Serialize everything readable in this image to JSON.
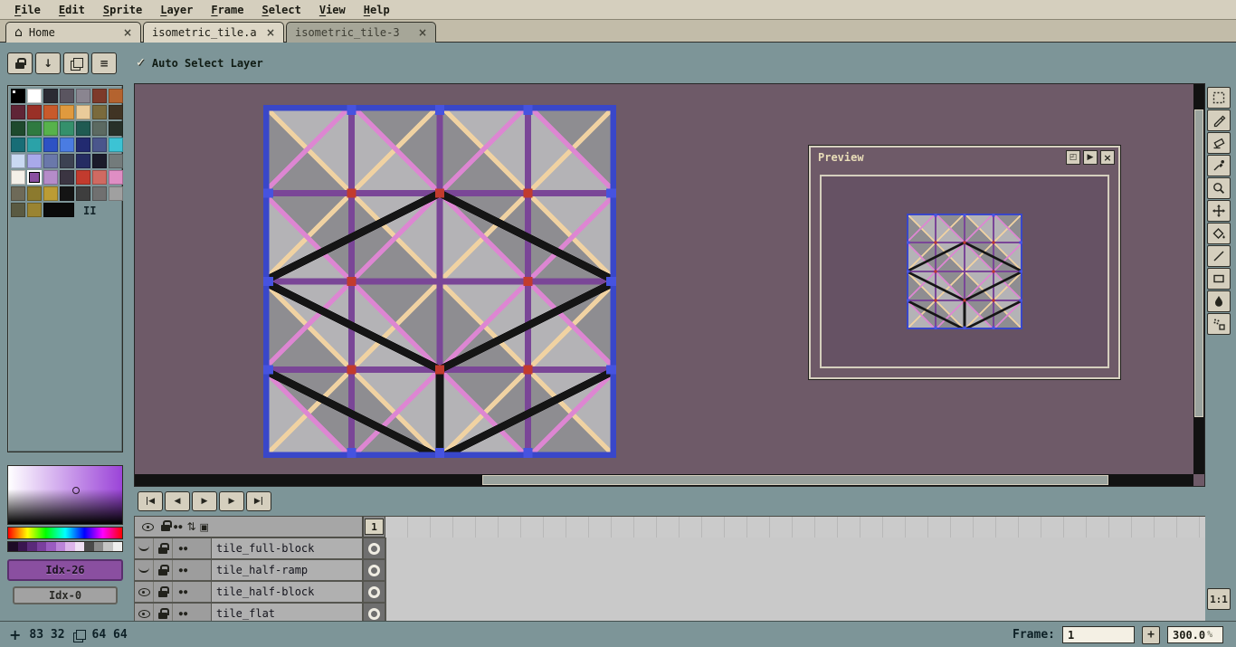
{
  "app": {
    "bg": "#7d9598",
    "canvas_bg": "#6e5a68",
    "panel_beige": "#d5cfbe",
    "accent_purple": "#8a4fa0",
    "sprite_colors": {
      "grid": "#7a4697",
      "pink": "#dd86d2",
      "peach": "#f0d2a2",
      "outline": "#151515",
      "border": "#3947c9",
      "light_gray": "#b4b3b6",
      "dark_gray": "#8e8d91",
      "marker_red": "#c23b2e",
      "marker_blue": "#4653e0"
    }
  },
  "menu": {
    "items": [
      "File",
      "Edit",
      "Sprite",
      "Layer",
      "Frame",
      "Select",
      "View",
      "Help"
    ]
  },
  "tabs": {
    "home": {
      "label": "Home",
      "icon": "⌂",
      "close": "×"
    },
    "doc1": {
      "label": "isometric_tile.a",
      "close": "×"
    },
    "doc2": {
      "label": "isometric_tile-3",
      "close": "×"
    }
  },
  "context_bar": {
    "check_glyph": "✓",
    "auto_select_label": "Auto Select Layer",
    "arrow_glyph": "↓",
    "menu_glyph": "≡"
  },
  "palette": {
    "colors": [
      "#000000",
      "#ffffff",
      "#2b2b33",
      "#5a5560",
      "#8a8590",
      "#7d3a2a",
      "#b4632f",
      "#5f2536",
      "#993027",
      "#c85a2b",
      "#e09a3e",
      "#eacb9a",
      "#7a6a3c",
      "#403424",
      "#1e4a2d",
      "#2f7a40",
      "#57b24b",
      "#35906c",
      "#1f5a52",
      "#5c6a62",
      "#273029",
      "#186d76",
      "#2ba2a8",
      "#2e52c4",
      "#4a7ce2",
      "#222a70",
      "#4a568c",
      "#3cc3d4",
      "#c9d9f2",
      "#a9a9ea",
      "#6a78aa",
      "#3c4252",
      "#252c62",
      "#1b1b2a",
      "#737b7b",
      "#f4f0e8",
      "#8a4fa0",
      "#b58cc9",
      "#3b3542",
      "#c23b2e",
      "#d06a62",
      "#df8ec4",
      "#6e6a58",
      "#8c7a2e",
      "#bb9c34",
      "#141414",
      "#3e3e3e",
      "#707070",
      "#a0a0a0",
      "#5a5a42",
      "#9a8432",
      "#0a0a0a"
    ],
    "fg_index": 36,
    "bg_index": 0,
    "index_label": "II"
  },
  "color_selector": {
    "shades": [
      "#1d0b26",
      "#3a1650",
      "#5a2a7a",
      "#7a3f9e",
      "#9a5cc0",
      "#bb84d8",
      "#dcb4ea",
      "#efe0f4",
      "#4a4a4a",
      "#8a8a8a",
      "#c4c4c4",
      "#efefef"
    ],
    "fg_label": "Idx-26",
    "bg_label": "Idx-0",
    "fg_color": "#8a4fa0",
    "bg_color": "#a2a2a2"
  },
  "preview": {
    "title": "Preview",
    "buttons": {
      "popout": "◰",
      "play": "▶",
      "close": "×"
    }
  },
  "tools": {
    "names": [
      "rectangular-marquee",
      "pencil",
      "eraser",
      "eyedropper",
      "zoom",
      "move",
      "paint-bucket",
      "line",
      "rectangle",
      "ink",
      "spray"
    ],
    "ratio_label": "1:1"
  },
  "timeline": {
    "playback": [
      {
        "name": "first-frame",
        "glyph": "|◀"
      },
      {
        "name": "prev-frame",
        "glyph": "◀"
      },
      {
        "name": "play",
        "glyph": "▶"
      },
      {
        "name": "next-frame",
        "glyph": "▶"
      },
      {
        "name": "last-frame",
        "glyph": "▶|"
      }
    ],
    "frame_number": "1",
    "layers": [
      {
        "name": "tile_full-block",
        "eye": "closed"
      },
      {
        "name": "tile_half-ramp",
        "eye": "closed"
      },
      {
        "name": "tile_half-block",
        "eye": "open"
      },
      {
        "name": "tile_flat",
        "eye": "open"
      }
    ]
  },
  "status_bar": {
    "position": "83 32",
    "size": "64 64",
    "frame_label": "Frame:",
    "frame_value": "1",
    "add_frame": "+",
    "zoom_value": "300.0",
    "zoom_unit": "%"
  }
}
